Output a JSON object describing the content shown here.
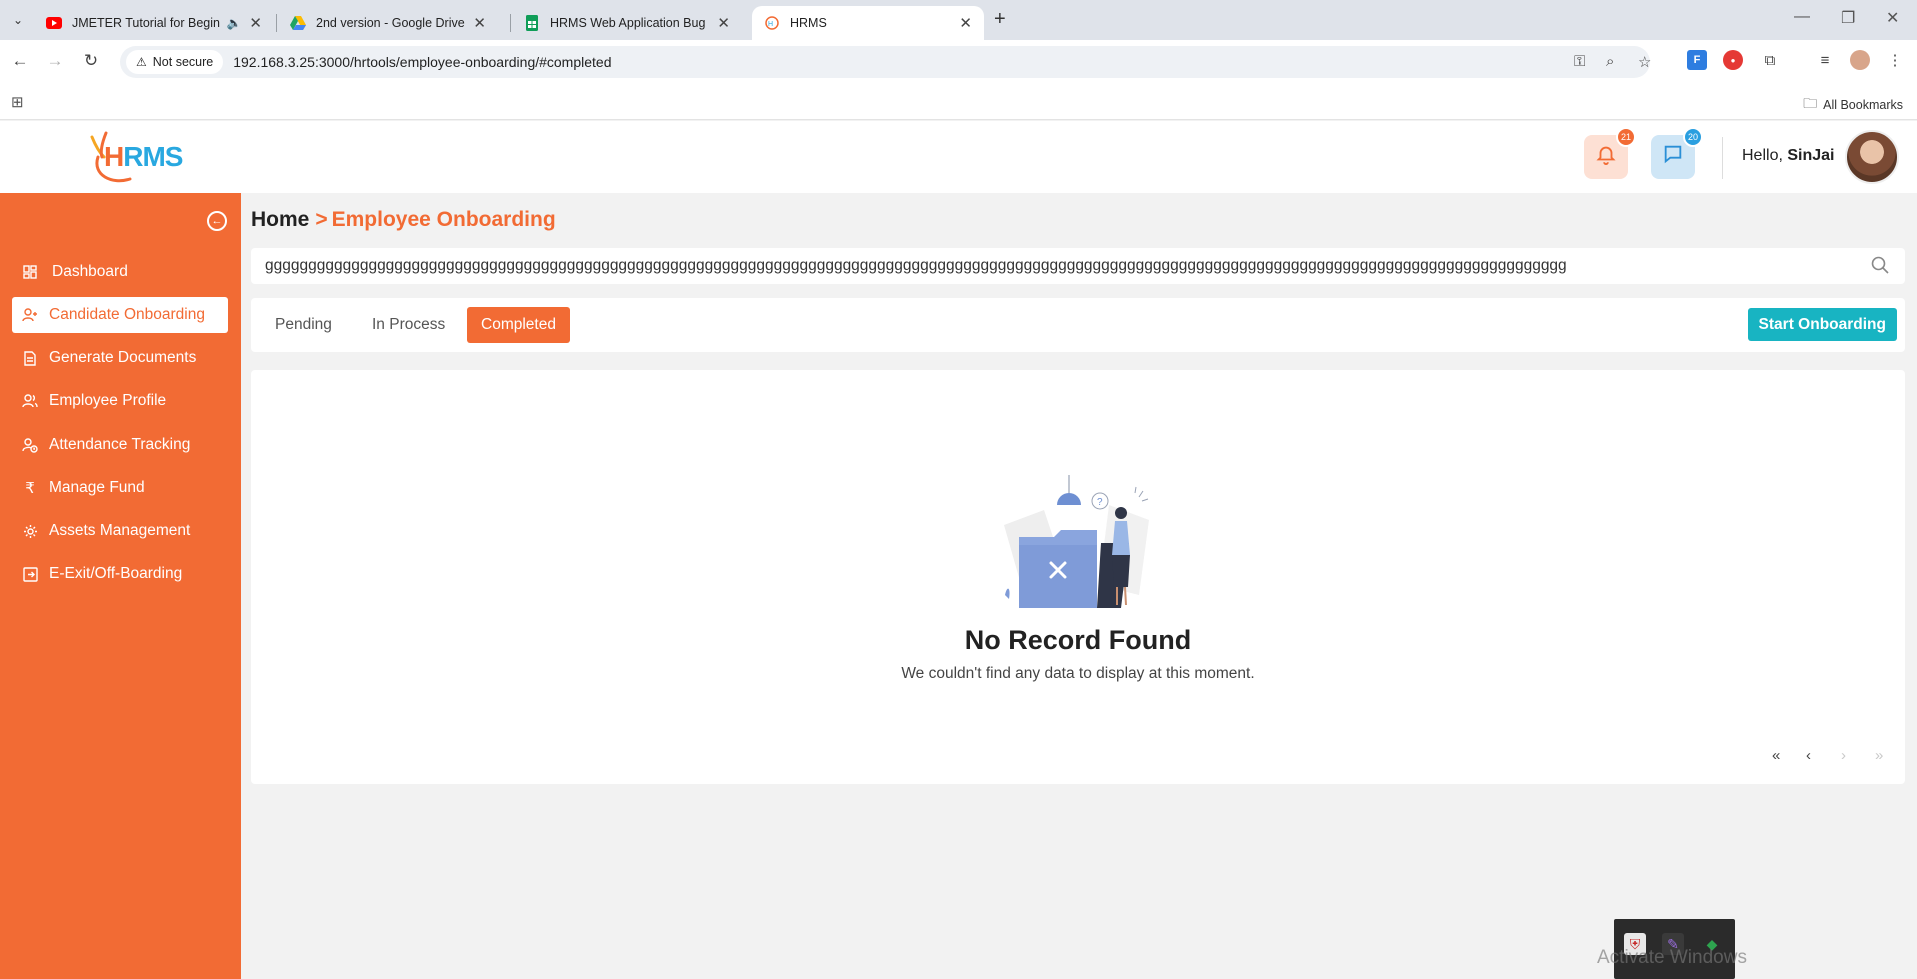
{
  "browser": {
    "tabs": [
      {
        "title": "JMETER Tutorial for Beginne",
        "favicon": "youtube-icon",
        "muted_icon": "speaker-icon"
      },
      {
        "title": "2nd version - Google Drive",
        "favicon": "google-drive-icon"
      },
      {
        "title": "HRMS Web Application Bug Re",
        "favicon": "google-sheets-icon"
      },
      {
        "title": "HRMS",
        "favicon": "hrms-icon",
        "active": true
      }
    ],
    "security_label": "Not secure",
    "url": "192.168.3.25:3000/hrtools/employee-onboarding/#completed",
    "bookmarks_label": "All Bookmarks"
  },
  "header": {
    "logo_h": "H",
    "logo_rms": "RMS",
    "notifications_count": "21",
    "messages_count": "20",
    "greeting_prefix": "Hello, ",
    "user_name": "SinJai"
  },
  "sidebar": {
    "items": [
      {
        "label": "Dashboard",
        "icon": "dashboard-icon"
      },
      {
        "label": "Candidate Onboarding",
        "icon": "user-plus-icon",
        "active": true
      },
      {
        "label": "Generate Documents",
        "icon": "document-icon"
      },
      {
        "label": "Employee Profile",
        "icon": "users-icon"
      },
      {
        "label": "Attendance Tracking",
        "icon": "user-clock-icon"
      },
      {
        "label": "Manage Fund",
        "icon": "rupee-icon"
      },
      {
        "label": "Assets Management",
        "icon": "assets-icon"
      },
      {
        "label": "E-Exit/Off-Boarding",
        "icon": "exit-icon"
      }
    ]
  },
  "breadcrumb": {
    "home": "Home",
    "separator": ">",
    "current": "Employee Onboarding"
  },
  "search": {
    "value": "ggggggggggggggggggggggggggggggggggggggggggggggggggggggggggggggggggggggggggggggggggggggggggggggggggggggggggggggggggggggggggggggggggggggggggggggggggggggg"
  },
  "status_tabs": [
    {
      "label": "Pending"
    },
    {
      "label": "In Process"
    },
    {
      "label": "Completed",
      "active": true
    }
  ],
  "start_button": "Start Onboarding",
  "empty_state": {
    "title": "No Record Found",
    "subtitle": "We couldn't find any data to display at this moment."
  },
  "pagination": {
    "first": "«",
    "prev": "‹",
    "next": "›",
    "last": "»"
  },
  "watermark": "Activate Windows",
  "colors": {
    "brand_orange": "#f26b34",
    "teal": "#18b4c2",
    "logo_blue": "#29a8e0"
  }
}
